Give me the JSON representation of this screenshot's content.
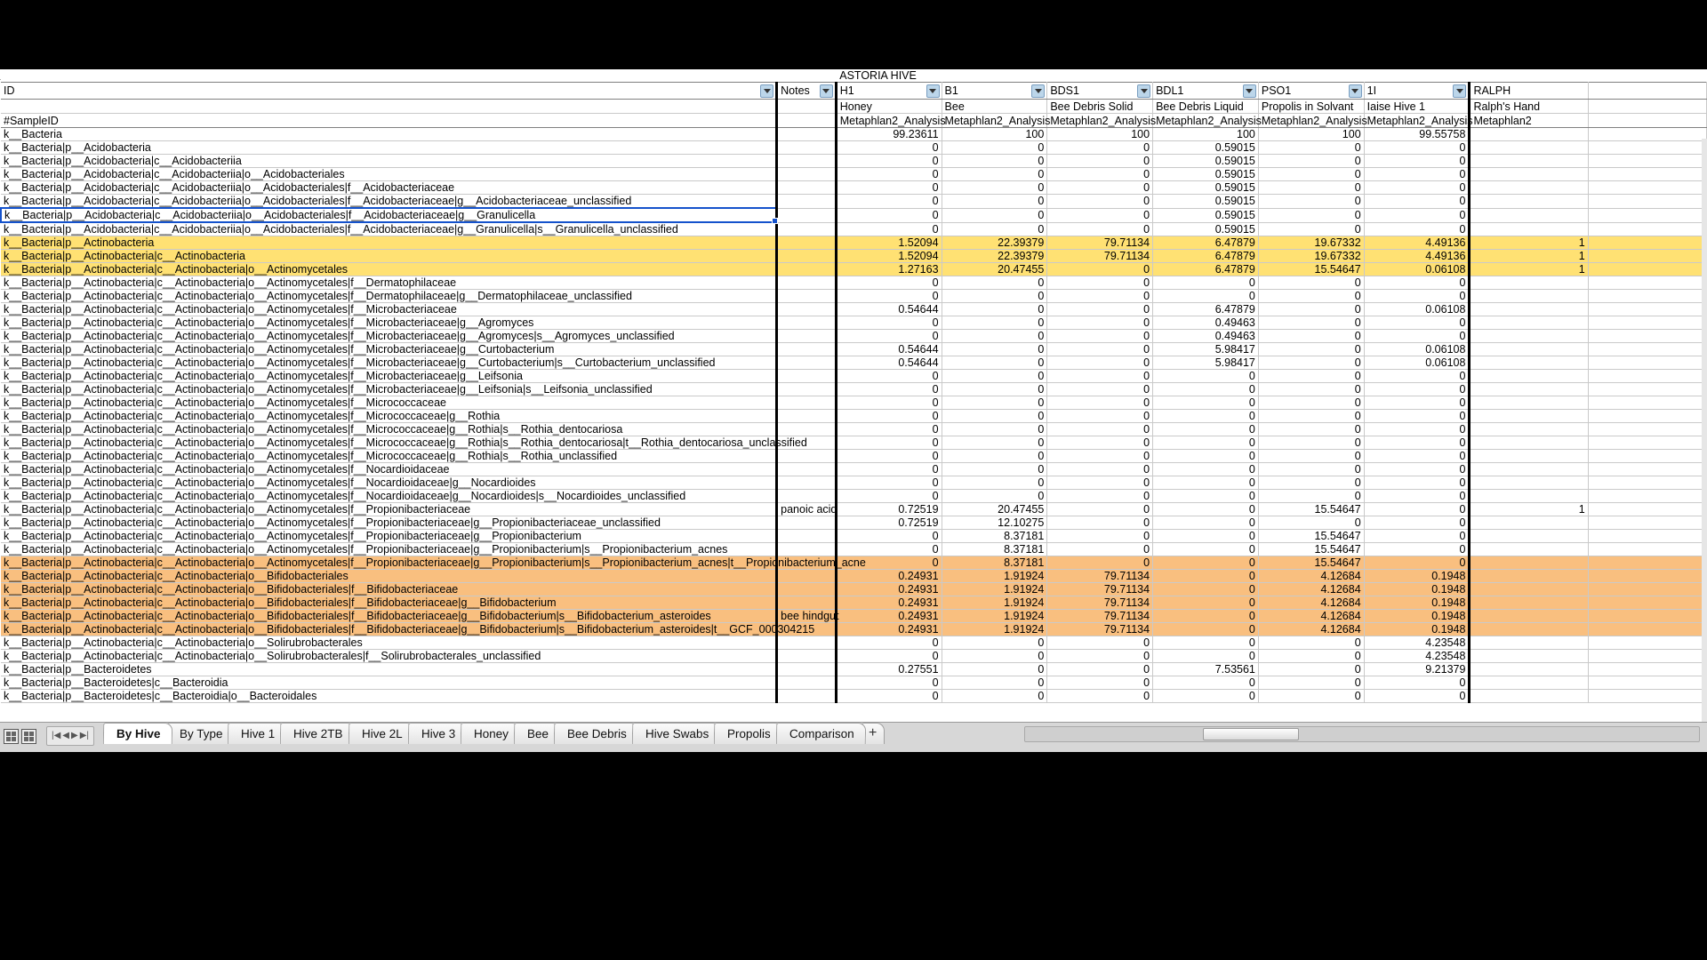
{
  "app": {
    "banner_label": "ASTORIA HIVE",
    "id_header": "ID",
    "notes_header": "Notes",
    "sample_id_label": "#SampleID"
  },
  "columns": [
    {
      "code": "H1",
      "sample": "Honey",
      "analysis": "Metaphlan2_Analysis"
    },
    {
      "code": "B1",
      "sample": "Bee",
      "analysis": "Metaphlan2_Analysis"
    },
    {
      "code": "BDS1",
      "sample": "Bee Debris Solid",
      "analysis": "Metaphlan2_Analysis"
    },
    {
      "code": "BDL1",
      "sample": "Bee Debris Liquid",
      "analysis": "Metaphlan2_Analysis"
    },
    {
      "code": "PSO1",
      "sample": "Propolis in Solvant",
      "analysis": "Metaphlan2_Analysis"
    },
    {
      "code": "1I",
      "sample": "Iaise Hive 1",
      "analysis": "Metaphlan2_Analysis"
    },
    {
      "code": "RALPH",
      "sample": "Ralph's Hand",
      "analysis": "Metaphlan2"
    }
  ],
  "rows": [
    {
      "id": "k__Bacteria",
      "note": "",
      "values": [
        "99.23611",
        "100",
        "100",
        "100",
        "100",
        "99.55758",
        ""
      ],
      "hl": "none",
      "selected": false
    },
    {
      "id": "k__Bacteria|p__Acidobacteria",
      "note": "",
      "values": [
        "0",
        "0",
        "0",
        "0.59015",
        "0",
        "0",
        ""
      ],
      "hl": "none",
      "selected": false
    },
    {
      "id": "k__Bacteria|p__Acidobacteria|c__Acidobacteriia",
      "note": "",
      "values": [
        "0",
        "0",
        "0",
        "0.59015",
        "0",
        "0",
        ""
      ],
      "hl": "none",
      "selected": false
    },
    {
      "id": "k__Bacteria|p__Acidobacteria|c__Acidobacteriia|o__Acidobacteriales",
      "note": "",
      "values": [
        "0",
        "0",
        "0",
        "0.59015",
        "0",
        "0",
        ""
      ],
      "hl": "none",
      "selected": false
    },
    {
      "id": "k__Bacteria|p__Acidobacteria|c__Acidobacteriia|o__Acidobacteriales|f__Acidobacteriaceae",
      "note": "",
      "values": [
        "0",
        "0",
        "0",
        "0.59015",
        "0",
        "0",
        ""
      ],
      "hl": "none",
      "selected": false
    },
    {
      "id": "k__Bacteria|p__Acidobacteria|c__Acidobacteriia|o__Acidobacteriales|f__Acidobacteriaceae|g__Acidobacteriaceae_unclassified",
      "note": "",
      "values": [
        "0",
        "0",
        "0",
        "0.59015",
        "0",
        "0",
        ""
      ],
      "hl": "none",
      "selected": false
    },
    {
      "id": "k__Bacteria|p__Acidobacteria|c__Acidobacteriia|o__Acidobacteriales|f__Acidobacteriaceae|g__Granulicella",
      "note": "",
      "values": [
        "0",
        "0",
        "0",
        "0.59015",
        "0",
        "0",
        ""
      ],
      "hl": "none",
      "selected": true
    },
    {
      "id": "k__Bacteria|p__Acidobacteria|c__Acidobacteriia|o__Acidobacteriales|f__Acidobacteriaceae|g__Granulicella|s__Granulicella_unclassified",
      "note": "",
      "values": [
        "0",
        "0",
        "0",
        "0.59015",
        "0",
        "0",
        ""
      ],
      "hl": "none",
      "selected": false
    },
    {
      "id": "k__Bacteria|p__Actinobacteria",
      "note": "",
      "values": [
        "1.52094",
        "22.39379",
        "79.71134",
        "6.47879",
        "19.67332",
        "4.49136",
        "1"
      ],
      "hl": "yellow",
      "selected": false
    },
    {
      "id": "k__Bacteria|p__Actinobacteria|c__Actinobacteria",
      "note": "",
      "values": [
        "1.52094",
        "22.39379",
        "79.71134",
        "6.47879",
        "19.67332",
        "4.49136",
        "1"
      ],
      "hl": "yellow",
      "selected": false
    },
    {
      "id": "k__Bacteria|p__Actinobacteria|c__Actinobacteria|o__Actinomycetales",
      "note": "",
      "values": [
        "1.27163",
        "20.47455",
        "0",
        "6.47879",
        "15.54647",
        "0.06108",
        "1"
      ],
      "hl": "yellow",
      "selected": false
    },
    {
      "id": "k__Bacteria|p__Actinobacteria|c__Actinobacteria|o__Actinomycetales|f__Dermatophilaceae",
      "note": "",
      "values": [
        "0",
        "0",
        "0",
        "0",
        "0",
        "0",
        ""
      ],
      "hl": "none",
      "selected": false
    },
    {
      "id": "k__Bacteria|p__Actinobacteria|c__Actinobacteria|o__Actinomycetales|f__Dermatophilaceae|g__Dermatophilaceae_unclassified",
      "note": "",
      "values": [
        "0",
        "0",
        "0",
        "0",
        "0",
        "0",
        ""
      ],
      "hl": "none",
      "selected": false
    },
    {
      "id": "k__Bacteria|p__Actinobacteria|c__Actinobacteria|o__Actinomycetales|f__Microbacteriaceae",
      "note": "",
      "values": [
        "0.54644",
        "0",
        "0",
        "6.47879",
        "0",
        "0.06108",
        ""
      ],
      "hl": "none",
      "selected": false
    },
    {
      "id": "k__Bacteria|p__Actinobacteria|c__Actinobacteria|o__Actinomycetales|f__Microbacteriaceae|g__Agromyces",
      "note": "",
      "values": [
        "0",
        "0",
        "0",
        "0.49463",
        "0",
        "0",
        ""
      ],
      "hl": "none",
      "selected": false
    },
    {
      "id": "k__Bacteria|p__Actinobacteria|c__Actinobacteria|o__Actinomycetales|f__Microbacteriaceae|g__Agromyces|s__Agromyces_unclassified",
      "note": "",
      "values": [
        "0",
        "0",
        "0",
        "0.49463",
        "0",
        "0",
        ""
      ],
      "hl": "none",
      "selected": false
    },
    {
      "id": "k__Bacteria|p__Actinobacteria|c__Actinobacteria|o__Actinomycetales|f__Microbacteriaceae|g__Curtobacterium",
      "note": "",
      "values": [
        "0.54644",
        "0",
        "0",
        "5.98417",
        "0",
        "0.06108",
        ""
      ],
      "hl": "none",
      "selected": false
    },
    {
      "id": "k__Bacteria|p__Actinobacteria|c__Actinobacteria|o__Actinomycetales|f__Microbacteriaceae|g__Curtobacterium|s__Curtobacterium_unclassified",
      "note": "",
      "values": [
        "0.54644",
        "0",
        "0",
        "5.98417",
        "0",
        "0.06108",
        ""
      ],
      "hl": "none",
      "selected": false
    },
    {
      "id": "k__Bacteria|p__Actinobacteria|c__Actinobacteria|o__Actinomycetales|f__Microbacteriaceae|g__Leifsonia",
      "note": "",
      "values": [
        "0",
        "0",
        "0",
        "0",
        "0",
        "0",
        ""
      ],
      "hl": "none",
      "selected": false
    },
    {
      "id": "k__Bacteria|p__Actinobacteria|c__Actinobacteria|o__Actinomycetales|f__Microbacteriaceae|g__Leifsonia|s__Leifsonia_unclassified",
      "note": "",
      "values": [
        "0",
        "0",
        "0",
        "0",
        "0",
        "0",
        ""
      ],
      "hl": "none",
      "selected": false
    },
    {
      "id": "k__Bacteria|p__Actinobacteria|c__Actinobacteria|o__Actinomycetales|f__Micrococcaceae",
      "note": "",
      "values": [
        "0",
        "0",
        "0",
        "0",
        "0",
        "0",
        ""
      ],
      "hl": "none",
      "selected": false
    },
    {
      "id": "k__Bacteria|p__Actinobacteria|c__Actinobacteria|o__Actinomycetales|f__Micrococcaceae|g__Rothia",
      "note": "",
      "values": [
        "0",
        "0",
        "0",
        "0",
        "0",
        "0",
        ""
      ],
      "hl": "none",
      "selected": false
    },
    {
      "id": "k__Bacteria|p__Actinobacteria|c__Actinobacteria|o__Actinomycetales|f__Micrococcaceae|g__Rothia|s__Rothia_dentocariosa",
      "note": "",
      "values": [
        "0",
        "0",
        "0",
        "0",
        "0",
        "0",
        ""
      ],
      "hl": "none",
      "selected": false
    },
    {
      "id": "k__Bacteria|p__Actinobacteria|c__Actinobacteria|o__Actinomycetales|f__Micrococcaceae|g__Rothia|s__Rothia_dentocariosa|t__Rothia_dentocariosa_unclassified",
      "note": "",
      "values": [
        "0",
        "0",
        "0",
        "0",
        "0",
        "0",
        ""
      ],
      "hl": "none",
      "selected": false
    },
    {
      "id": "k__Bacteria|p__Actinobacteria|c__Actinobacteria|o__Actinomycetales|f__Micrococcaceae|g__Rothia|s__Rothia_unclassified",
      "note": "",
      "values": [
        "0",
        "0",
        "0",
        "0",
        "0",
        "0",
        ""
      ],
      "hl": "none",
      "selected": false
    },
    {
      "id": "k__Bacteria|p__Actinobacteria|c__Actinobacteria|o__Actinomycetales|f__Nocardioidaceae",
      "note": "",
      "values": [
        "0",
        "0",
        "0",
        "0",
        "0",
        "0",
        ""
      ],
      "hl": "none",
      "selected": false
    },
    {
      "id": "k__Bacteria|p__Actinobacteria|c__Actinobacteria|o__Actinomycetales|f__Nocardioidaceae|g__Nocardioides",
      "note": "",
      "values": [
        "0",
        "0",
        "0",
        "0",
        "0",
        "0",
        ""
      ],
      "hl": "none",
      "selected": false
    },
    {
      "id": "k__Bacteria|p__Actinobacteria|c__Actinobacteria|o__Actinomycetales|f__Nocardioidaceae|g__Nocardioides|s__Nocardioides_unclassified",
      "note": "",
      "values": [
        "0",
        "0",
        "0",
        "0",
        "0",
        "0",
        ""
      ],
      "hl": "none",
      "selected": false
    },
    {
      "id": "k__Bacteria|p__Actinobacteria|c__Actinobacteria|o__Actinomycetales|f__Propionibacteriaceae",
      "note": "panoic acid",
      "values": [
        "0.72519",
        "20.47455",
        "0",
        "0",
        "15.54647",
        "0",
        "1"
      ],
      "hl": "none",
      "selected": false
    },
    {
      "id": "k__Bacteria|p__Actinobacteria|c__Actinobacteria|o__Actinomycetales|f__Propionibacteriaceae|g__Propionibacteriaceae_unclassified",
      "note": "",
      "values": [
        "0.72519",
        "12.10275",
        "0",
        "0",
        "0",
        "0",
        ""
      ],
      "hl": "none",
      "selected": false
    },
    {
      "id": "k__Bacteria|p__Actinobacteria|c__Actinobacteria|o__Actinomycetales|f__Propionibacteriaceae|g__Propionibacterium",
      "note": "",
      "values": [
        "0",
        "8.37181",
        "0",
        "0",
        "15.54647",
        "0",
        ""
      ],
      "hl": "none",
      "selected": false
    },
    {
      "id": "k__Bacteria|p__Actinobacteria|c__Actinobacteria|o__Actinomycetales|f__Propionibacteriaceae|g__Propionibacterium|s__Propionibacterium_acnes",
      "note": "",
      "values": [
        "0",
        "8.37181",
        "0",
        "0",
        "15.54647",
        "0",
        ""
      ],
      "hl": "none",
      "selected": false
    },
    {
      "id": "k__Bacteria|p__Actinobacteria|c__Actinobacteria|o__Actinomycetales|f__Propionibacteriaceae|g__Propionibacterium|s__Propionibacterium_acnes|t__Propionibacterium_acne",
      "note": "",
      "values": [
        "0",
        "8.37181",
        "0",
        "0",
        "15.54647",
        "0",
        ""
      ],
      "hl": "orange",
      "selected": false
    },
    {
      "id": "k__Bacteria|p__Actinobacteria|c__Actinobacteria|o__Bifidobacteriales",
      "note": "",
      "values": [
        "0.24931",
        "1.91924",
        "79.71134",
        "0",
        "4.12684",
        "0.1948",
        ""
      ],
      "hl": "orange",
      "selected": false
    },
    {
      "id": "k__Bacteria|p__Actinobacteria|c__Actinobacteria|o__Bifidobacteriales|f__Bifidobacteriaceae",
      "note": "",
      "values": [
        "0.24931",
        "1.91924",
        "79.71134",
        "0",
        "4.12684",
        "0.1948",
        ""
      ],
      "hl": "orange",
      "selected": false
    },
    {
      "id": "k__Bacteria|p__Actinobacteria|c__Actinobacteria|o__Bifidobacteriales|f__Bifidobacteriaceae|g__Bifidobacterium",
      "note": "",
      "values": [
        "0.24931",
        "1.91924",
        "79.71134",
        "0",
        "4.12684",
        "0.1948",
        ""
      ],
      "hl": "orange",
      "selected": false
    },
    {
      "id": "k__Bacteria|p__Actinobacteria|c__Actinobacteria|o__Bifidobacteriales|f__Bifidobacteriaceae|g__Bifidobacterium|s__Bifidobacterium_asteroides",
      "note": "bee hindgut",
      "values": [
        "0.24931",
        "1.91924",
        "79.71134",
        "0",
        "4.12684",
        "0.1948",
        ""
      ],
      "hl": "orange",
      "selected": false
    },
    {
      "id": "k__Bacteria|p__Actinobacteria|c__Actinobacteria|o__Bifidobacteriales|f__Bifidobacteriaceae|g__Bifidobacterium|s__Bifidobacterium_asteroides|t__GCF_000304215",
      "note": "",
      "values": [
        "0.24931",
        "1.91924",
        "79.71134",
        "0",
        "4.12684",
        "0.1948",
        ""
      ],
      "hl": "orange",
      "selected": false
    },
    {
      "id": "k__Bacteria|p__Actinobacteria|c__Actinobacteria|o__Solirubrobacterales",
      "note": "",
      "values": [
        "0",
        "0",
        "0",
        "0",
        "0",
        "4.23548",
        ""
      ],
      "hl": "none",
      "selected": false
    },
    {
      "id": "k__Bacteria|p__Actinobacteria|c__Actinobacteria|o__Solirubrobacterales|f__Solirubrobacterales_unclassified",
      "note": "",
      "values": [
        "0",
        "0",
        "0",
        "0",
        "0",
        "4.23548",
        ""
      ],
      "hl": "none",
      "selected": false
    },
    {
      "id": "k__Bacteria|p__Bacteroidetes",
      "note": "",
      "values": [
        "0.27551",
        "0",
        "0",
        "7.53561",
        "0",
        "9.21379",
        ""
      ],
      "hl": "none",
      "selected": false
    },
    {
      "id": "k__Bacteria|p__Bacteroidetes|c__Bacteroidia",
      "note": "",
      "values": [
        "0",
        "0",
        "0",
        "0",
        "0",
        "0",
        ""
      ],
      "hl": "none",
      "selected": false
    },
    {
      "id": "k__Bacteria|p__Bacteroidetes|c__Bacteroidia|o__Bacteroidales",
      "note": "",
      "values": [
        "0",
        "0",
        "0",
        "0",
        "0",
        "0",
        ""
      ],
      "hl": "none",
      "selected": false
    }
  ],
  "sheet_tabs": [
    {
      "label": "By Hive",
      "active": true
    },
    {
      "label": "By Type",
      "active": false
    },
    {
      "label": "Hive 1",
      "active": false
    },
    {
      "label": "Hive 2TB",
      "active": false
    },
    {
      "label": "Hive 2L",
      "active": false
    },
    {
      "label": "Hive 3",
      "active": false
    },
    {
      "label": "Honey",
      "active": false
    },
    {
      "label": "Bee",
      "active": false
    },
    {
      "label": "Bee Debris",
      "active": false
    },
    {
      "label": "Hive Swabs",
      "active": false
    },
    {
      "label": "Propolis",
      "active": false
    },
    {
      "label": "Comparison",
      "active": false
    }
  ],
  "tabbar": {
    "add_label": "+",
    "nav_first": "|◀",
    "nav_prev": "◀",
    "nav_next": "▶",
    "nav_last": "▶|"
  }
}
